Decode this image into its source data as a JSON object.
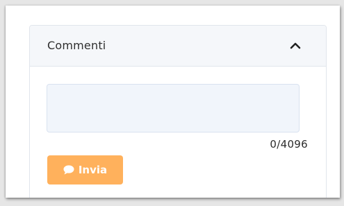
{
  "comments_panel": {
    "title": "Commenti",
    "collapse_icon": "chevron-up-icon",
    "comment_field": {
      "value": "",
      "placeholder": ""
    },
    "char_counter": "0/4096",
    "send_button": {
      "label": "Invia",
      "icon": "chat-bubble-icon"
    }
  },
  "colors": {
    "accent": "#ffb15c",
    "header_bg": "#f5f7fa",
    "input_bg": "#f1f5fb"
  }
}
